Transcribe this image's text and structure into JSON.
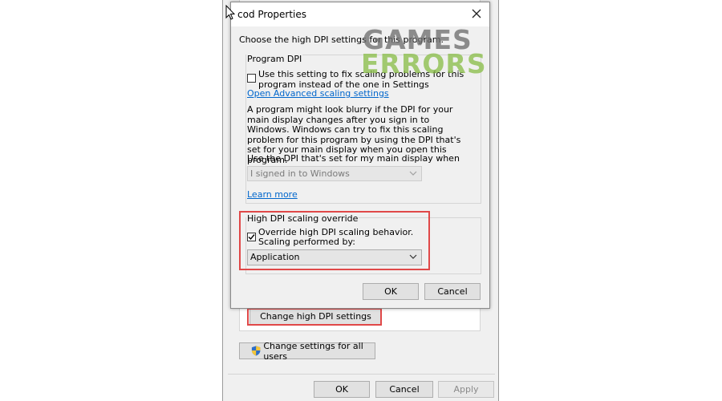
{
  "background_window": {
    "change_dpi_button": "Change high DPI settings",
    "change_all_users_button": "Change settings for all users",
    "ok_button": "OK",
    "cancel_button": "Cancel",
    "apply_button": "Apply"
  },
  "dialog": {
    "title": "cod Properties",
    "intro": "Choose the high DPI settings for this program.",
    "program_dpi": {
      "group_title": "Program DPI",
      "checkbox_label": "Use this setting to fix scaling problems for this program instead of the one in Settings",
      "checked": false,
      "advanced_link": "Open Advanced scaling settings",
      "description": "A program might look blurry if the DPI for your main display changes after you sign in to Windows. Windows can try to fix this scaling problem for this program by using the DPI that's set for your main display when you open this program.",
      "use_dpi_label": "Use the DPI that's set for my main display when",
      "dpi_select_value": "I signed in to Windows",
      "learn_more_link": "Learn more"
    },
    "override": {
      "group_title": "High DPI scaling override",
      "checkbox_label": "Override high DPI scaling behavior. Scaling performed by:",
      "checked": true,
      "select_value": "Application"
    },
    "ok_button": "OK",
    "cancel_button": "Cancel"
  },
  "watermark": {
    "line1": "GAMES",
    "line2": "ERRORS"
  },
  "colors": {
    "highlight": "#e04848",
    "link": "#0066cc",
    "watermark_grey": "#6e6e6e",
    "watermark_green": "#8abe4a"
  }
}
